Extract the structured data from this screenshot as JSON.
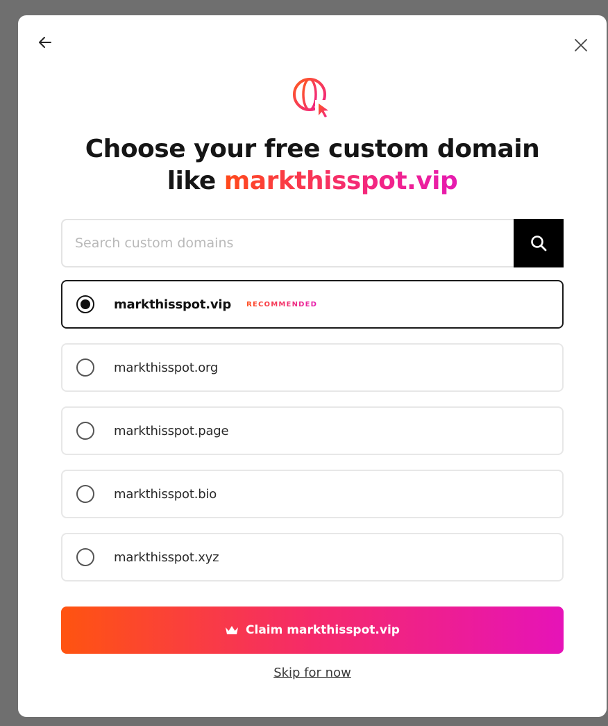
{
  "header": {
    "back_icon": "arrow-left-icon",
    "close_icon": "close-icon",
    "globe_icon": "globe-cursor-icon"
  },
  "title": {
    "line1": "Choose your free custom domain",
    "prefix": "like ",
    "highlight": "markthisspot.vip"
  },
  "search": {
    "placeholder": "Search custom domains",
    "value": "",
    "icon": "search-icon"
  },
  "options": [
    {
      "label": "markthisspot.vip",
      "badge": "RECOMMENDED",
      "selected": true
    },
    {
      "label": "markthisspot.org",
      "selected": false
    },
    {
      "label": "markthisspot.page",
      "selected": false
    },
    {
      "label": "markthisspot.bio",
      "selected": false
    },
    {
      "label": "markthisspot.xyz",
      "selected": false
    }
  ],
  "claim": {
    "label": "Claim markthisspot.vip",
    "icon": "crown-icon"
  },
  "skip": {
    "label": "Skip for now"
  },
  "colors": {
    "accent_start": "#ff5410",
    "accent_end": "#e613b8",
    "search_button": "#000000"
  }
}
